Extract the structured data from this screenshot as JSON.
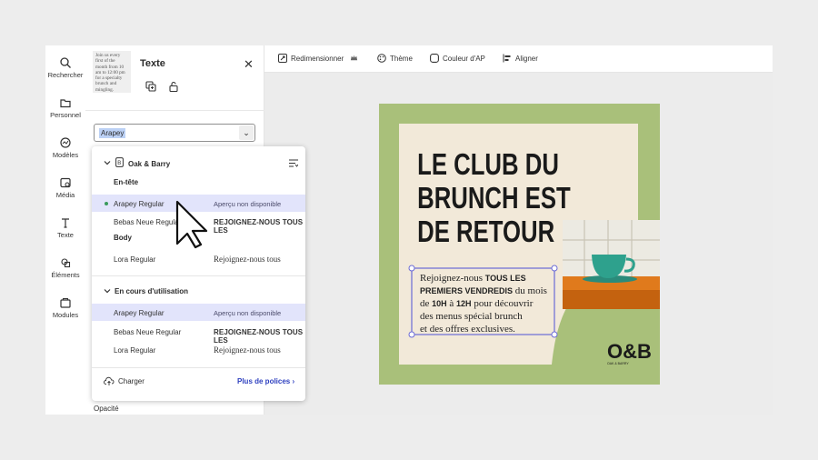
{
  "rail": {
    "items": [
      {
        "label": "Rechercher",
        "icon": "search-icon"
      },
      {
        "label": "Personnel",
        "icon": "folder-icon"
      },
      {
        "label": "Modèles",
        "icon": "templates-icon"
      },
      {
        "label": "Média",
        "icon": "media-icon"
      },
      {
        "label": "Texte",
        "icon": "text-icon"
      },
      {
        "label": "Éléments",
        "icon": "elements-icon"
      },
      {
        "label": "Modules",
        "icon": "modules-icon"
      }
    ]
  },
  "panel": {
    "title": "Texte",
    "thumbnail_text": "Join us every first of the month from 10 am to 12:00 pm for a specialty brunch and mingling.",
    "font_value": "Arapey",
    "opacity_label": "Opacité"
  },
  "dropdown": {
    "brand_name": "Oak & Barry",
    "heading_label": "En-tête",
    "body_label": "Body",
    "in_use_label": "En cours d'utilisation",
    "upload_label": "Charger",
    "more_fonts_label": "Plus de polices",
    "brand_fonts": [
      {
        "name": "Arapey Regular",
        "preview": "Aperçu non disponible"
      },
      {
        "name": "Bebas Neue Regular",
        "preview": "REJOIGNEZ-NOUS TOUS LES"
      },
      {
        "name": "Lora Regular",
        "preview": "Rejoignez-nous tous"
      }
    ],
    "in_use_fonts": [
      {
        "name": "Arapey Regular",
        "preview": "Aperçu non disponible"
      },
      {
        "name": "Bebas Neue Regular",
        "preview": "REJOIGNEZ-NOUS TOUS LES"
      },
      {
        "name": "Lora Regular",
        "preview": "Rejoignez-nous tous"
      }
    ]
  },
  "toolbar": {
    "resize_label": "Redimensionner",
    "theme_label": "Thème",
    "color_label": "Couleur d'AP",
    "align_label": "Aligner"
  },
  "poster": {
    "headline_line1": "LE CLUB DU",
    "headline_line2": "BRUNCH EST",
    "headline_line3": "DE RETOUR !",
    "body_seg1": "Rejoignez-nous ",
    "body_bold1": "TOUS LES",
    "body_bold2": "PREMIERS VENDREDIS",
    "body_seg2": " du mois",
    "body_seg3": "de ",
    "body_bold3": "10H",
    "body_seg4": " à ",
    "body_bold4": "12H",
    "body_seg5": " pour découvrir",
    "body_line4": "des menus spécial brunch",
    "body_line5": "et des offres exclusives.",
    "logo": "O&B",
    "logo_sub": "OAK & BARRY"
  },
  "colors": {
    "poster_green": "#a9c07a",
    "poster_cream": "#f2e9d9",
    "selection": "#6b6bd6",
    "dropdown_selected": "#e2e4fb",
    "dot_green": "#3a9a5c"
  }
}
